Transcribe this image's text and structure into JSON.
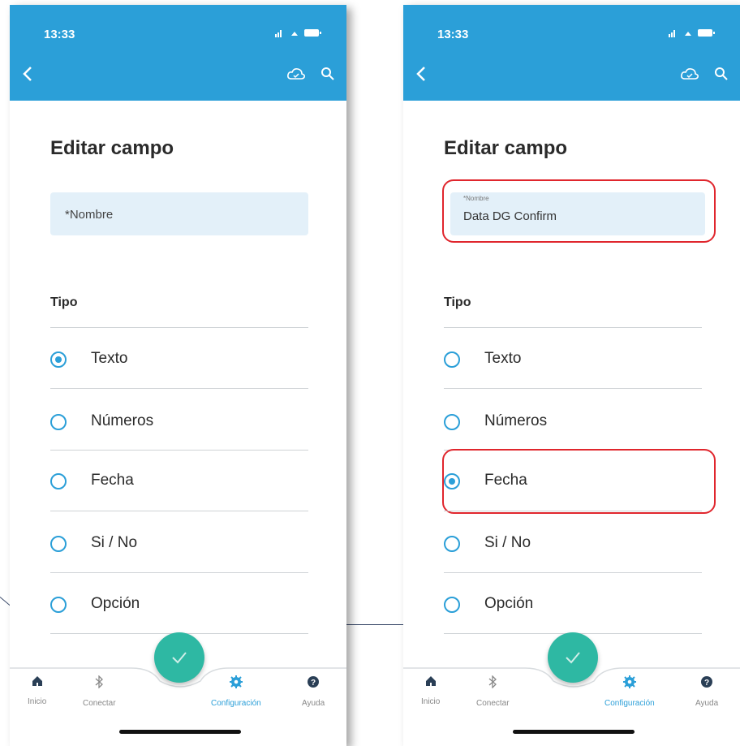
{
  "screens": [
    {
      "status": {
        "time": "13:33",
        "icons": "••• ◠ ▭"
      },
      "title": "Editar campo",
      "name_field": {
        "placeholder": "*Nombre",
        "label": "",
        "value": ""
      },
      "tipo_label": "Tipo",
      "options": [
        "Texto",
        "Números",
        "Fecha",
        "Si / No",
        "Opción"
      ],
      "selected_option": "Texto",
      "nav": [
        "Inicio",
        "Conectar",
        "Configuración",
        "Ayuda"
      ],
      "active_nav": "Configuración"
    },
    {
      "status": {
        "time": "13:33",
        "icons": "••• ◠ ▭"
      },
      "title": "Editar campo",
      "name_field": {
        "placeholder": "",
        "label": "*Nombre",
        "value": "Data DG Confirm"
      },
      "tipo_label": "Tipo",
      "options": [
        "Texto",
        "Números",
        "Fecha",
        "Si / No",
        "Opción"
      ],
      "selected_option": "Fecha",
      "nav": [
        "Inicio",
        "Conectar",
        "Configuración",
        "Ayuda"
      ],
      "active_nav": "Configuración"
    }
  ],
  "colors": {
    "header": "#2b9fd8",
    "accent": "#2b9fd8",
    "fab": "#2eb8a3",
    "highlight": "#e0262d",
    "field_bg": "#e3f0f9"
  },
  "icons": [
    "back-arrow",
    "cloud-sync",
    "search",
    "home",
    "bluetooth",
    "gear",
    "help",
    "checkmark"
  ]
}
